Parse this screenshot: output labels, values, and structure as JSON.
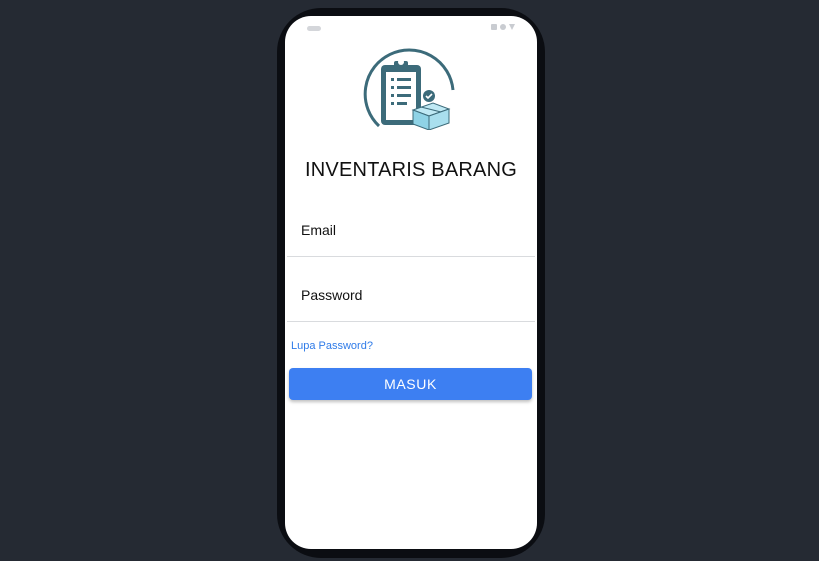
{
  "app": {
    "title": "INVENTARIS BARANG"
  },
  "form": {
    "email_placeholder": "Email",
    "password_placeholder": "Password",
    "forgot_password_label": "Lupa Password?",
    "submit_label": "MASUK"
  },
  "icons": {
    "logo": "clipboard-box-icon",
    "status": [
      "status-pill-icon",
      "signal-icon",
      "battery-icon",
      "wifi-icon"
    ]
  },
  "colors": {
    "background": "#252a33",
    "phone_frame": "#0b0d12",
    "screen": "#ffffff",
    "accent": "#3d7ff2",
    "link": "#2f7be8",
    "logo_teal": "#3c6b7a",
    "logo_box": "#8fd3e6"
  }
}
